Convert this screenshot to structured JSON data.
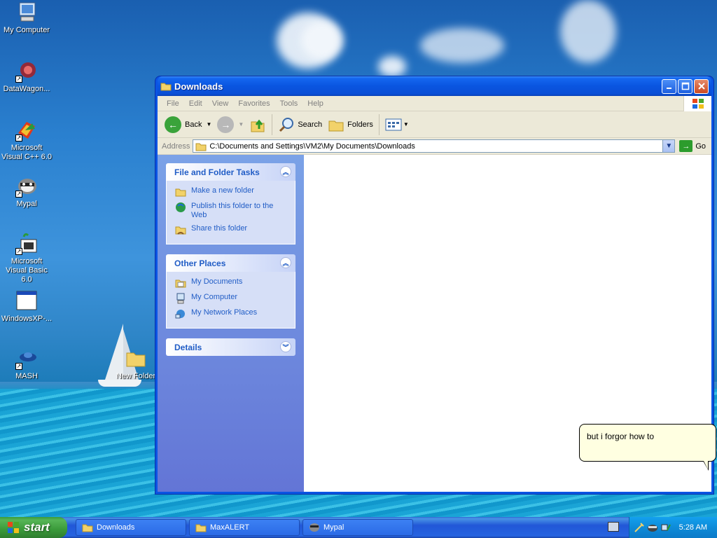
{
  "desktop": {
    "icons": [
      {
        "label": "My Computer"
      },
      {
        "label": "DataWagon..."
      },
      {
        "label": "Microsoft Visual C++ 6.0"
      },
      {
        "label": "Mypal"
      },
      {
        "label": "Microsoft Visual Basic 6.0"
      },
      {
        "label": "WindowsXP-..."
      },
      {
        "label": "MASH"
      },
      {
        "label": "New Folder"
      }
    ]
  },
  "window": {
    "title": "Downloads",
    "menu": [
      "File",
      "Edit",
      "View",
      "Favorites",
      "Tools",
      "Help"
    ],
    "toolbar": {
      "back_label": "Back",
      "search_label": "Search",
      "folders_label": "Folders"
    },
    "address": {
      "label": "Address",
      "value": "C:\\Documents and Settings\\VM2\\My Documents\\Downloads",
      "go_label": "Go"
    },
    "taskpane": {
      "file_tasks": {
        "title": "File and Folder Tasks",
        "items": [
          "Make a new folder",
          "Publish this folder to the Web",
          "Share this folder"
        ]
      },
      "other_places": {
        "title": "Other Places",
        "items": [
          "My Documents",
          "My Computer",
          "My Network Places"
        ]
      },
      "details": {
        "title": "Details"
      }
    }
  },
  "balloon": {
    "text": "but i forgor how to"
  },
  "taskbar": {
    "start_label": "start",
    "tasks": [
      "Downloads",
      "MaxALERT",
      "Mypal"
    ],
    "clock": "5:28 AM"
  },
  "colors": {
    "titlebar": "#0a55e0",
    "taskpane_link": "#215dc6",
    "start_green": "#3a9a3a"
  }
}
